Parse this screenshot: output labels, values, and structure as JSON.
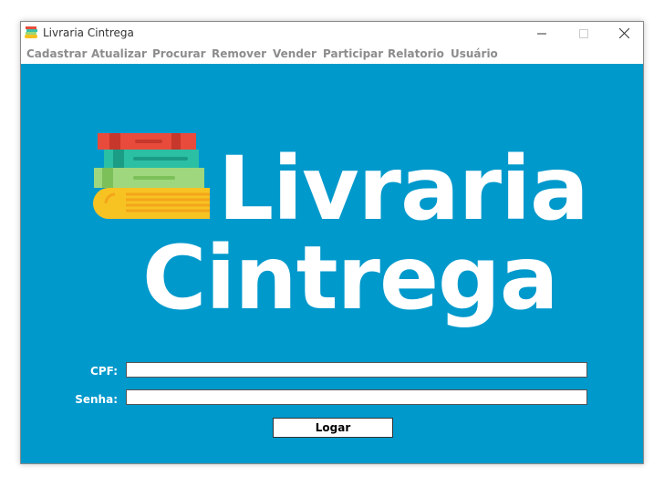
{
  "window": {
    "title": "Livraria Cintrega",
    "controls": {
      "minimize": "minimize",
      "maximize": "maximize",
      "close": "close"
    }
  },
  "menu": {
    "items": [
      "Cadastrar",
      "Atualizar",
      "Procurar",
      "Remover",
      "Vender",
      "Participar",
      "Relatorio",
      "Usuário"
    ]
  },
  "brand": {
    "line1": "Livraria",
    "line2": "Cintrega",
    "icon": "books-stack-icon"
  },
  "form": {
    "cpf_label": "CPF:",
    "cpf_value": "",
    "senha_label": "Senha:",
    "senha_value": "",
    "login_button": "Logar"
  },
  "colors": {
    "background": "#0099cc",
    "text": "#ffffff",
    "menu_text": "#8c8c8c"
  }
}
